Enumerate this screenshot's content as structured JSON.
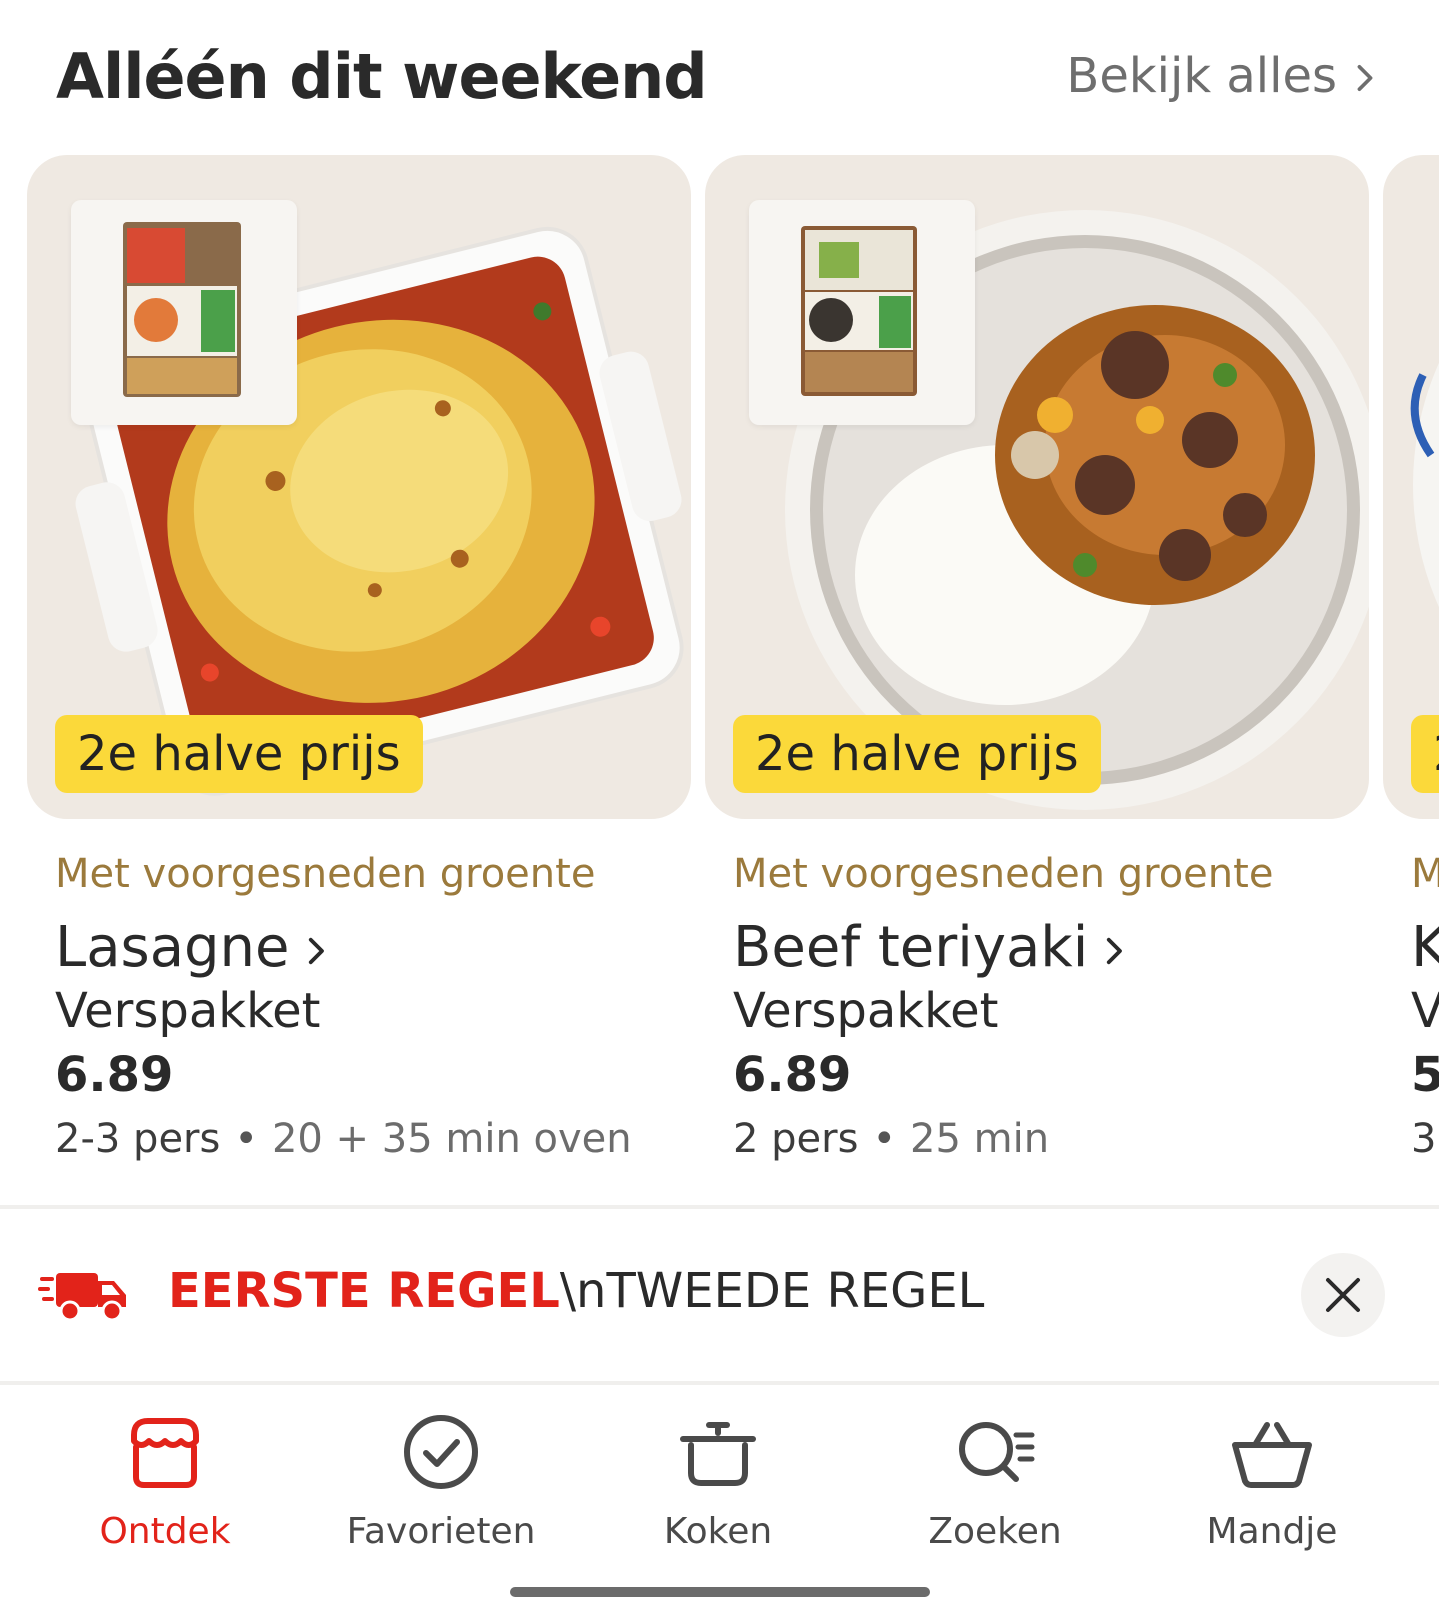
{
  "section": {
    "title": "Alléén dit weekend",
    "see_all": "Bekijk alles"
  },
  "cards": [
    {
      "badge": "2e halve prijs",
      "subtitle": "Met voorgesneden groente",
      "name": "Lasagne",
      "type": "Verspakket",
      "price": "6.89",
      "persons": "2-3 pers",
      "separator": "•",
      "time": "20 + 35 min oven"
    },
    {
      "badge": "2e halve prijs",
      "subtitle": "Met voorgesneden groente",
      "name": "Beef teriyaki",
      "type": "Verspakket",
      "price": "6.89",
      "persons": "2 pers",
      "separator": "•",
      "time": "25 min"
    },
    {
      "badge": "2",
      "subtitle": "M",
      "name": "K",
      "type": "V",
      "price": "5",
      "persons": "3",
      "separator": "",
      "time": ""
    }
  ],
  "banner": {
    "line1": "EERSTE REGEL",
    "line2": "\\nTWEEDE REGEL",
    "icon": "delivery-truck-icon"
  },
  "nav": {
    "items": [
      {
        "label": "Ontdek",
        "icon": "store-icon",
        "active": true
      },
      {
        "label": "Favorieten",
        "icon": "check-circle-icon",
        "active": false
      },
      {
        "label": "Koken",
        "icon": "cooking-pot-icon",
        "active": false
      },
      {
        "label": "Zoeken",
        "icon": "search-list-icon",
        "active": false
      },
      {
        "label": "Mandje",
        "icon": "basket-icon",
        "active": false
      }
    ]
  },
  "colors": {
    "accent_red": "#e2231a",
    "badge_yellow": "#fbd93a",
    "card_bg": "#efe9e2",
    "subtitle_gold": "#9b7a3c"
  }
}
